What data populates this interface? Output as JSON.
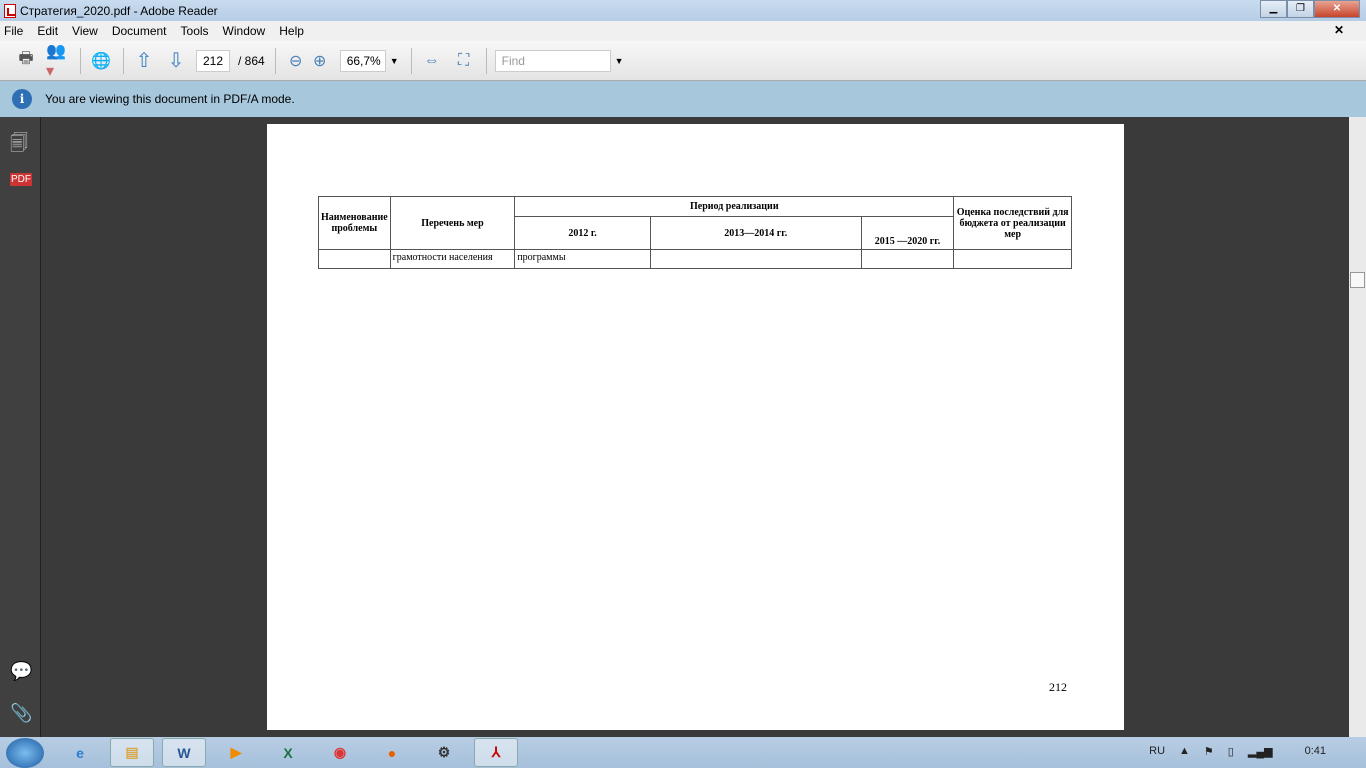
{
  "window": {
    "title": "Стратегия_2020.pdf - Adobe Reader"
  },
  "menu": [
    "File",
    "Edit",
    "View",
    "Document",
    "Tools",
    "Window",
    "Help"
  ],
  "toolbar": {
    "page_current": "212",
    "page_total": "/ 864",
    "zoom": "66,7%",
    "find_placeholder": "Find"
  },
  "infobar": {
    "message": "You are viewing this document in PDF/A mode."
  },
  "document": {
    "table": {
      "h_name": "Наименование проблемы",
      "h_measures": "Перечень мер",
      "h_period": "Период реализации",
      "h_2012": "2012 г.",
      "h_2013": "2013—2014 гг.",
      "h_2015": "2015 —2020 гг.",
      "h_assessment": "Оценка последствий для бюджета от реализации мер",
      "row": [
        "",
        "грамотности населения",
        "программы",
        "",
        "",
        ""
      ]
    },
    "page_number": "212"
  },
  "taskbar": {
    "lang": "RU",
    "clock": "0:41"
  }
}
